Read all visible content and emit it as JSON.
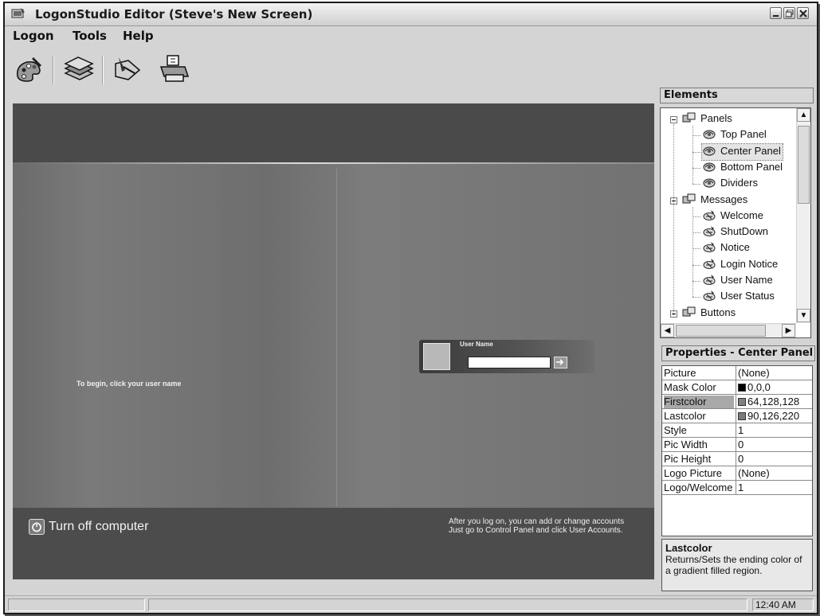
{
  "window": {
    "title": "LogonStudio Editor (Steve's New Screen)",
    "icons": {
      "app": "logonstudio-app-icon",
      "minimize": "minimize-icon",
      "maximize": "maximize-icon",
      "close": "close-icon"
    }
  },
  "menu": {
    "items": [
      "Logon",
      "Tools",
      "Help"
    ]
  },
  "toolbar": {
    "buttons": [
      {
        "icon": "palette-icon"
      },
      {
        "icon": "layers-icon"
      },
      {
        "icon": "pointer-hand-icon"
      },
      {
        "icon": "printer-icon"
      }
    ]
  },
  "preview": {
    "welcome_text": "To begin, click your user name",
    "user_name_label": "User Name",
    "password_value": "",
    "go_icon": "go-arrow-icon",
    "turn_off_label": "Turn off computer",
    "power_icon": "power-icon",
    "after_logon_line1": "After you log on, you can add or change accounts",
    "after_logon_line2": "Just go to Control Panel and click User Accounts."
  },
  "elements": {
    "heading": "Elements",
    "tree": [
      {
        "label": "Panels",
        "level": 0,
        "expanded": true,
        "icon": "folder-group-icon"
      },
      {
        "label": "Top Panel",
        "level": 1,
        "icon": "panel-item-icon"
      },
      {
        "label": "Center Panel",
        "level": 1,
        "icon": "panel-item-icon",
        "selected": true
      },
      {
        "label": "Bottom Panel",
        "level": 1,
        "icon": "panel-item-icon"
      },
      {
        "label": "Dividers",
        "level": 1,
        "icon": "panel-item-icon"
      },
      {
        "label": "Messages",
        "level": 0,
        "expanded": true,
        "icon": "folder-group-icon"
      },
      {
        "label": "Welcome",
        "level": 1,
        "icon": "message-item-icon"
      },
      {
        "label": "ShutDown",
        "level": 1,
        "icon": "message-item-icon"
      },
      {
        "label": "Notice",
        "level": 1,
        "icon": "message-item-icon"
      },
      {
        "label": "Login Notice",
        "level": 1,
        "icon": "message-item-icon"
      },
      {
        "label": "User Name",
        "level": 1,
        "icon": "message-item-icon"
      },
      {
        "label": "User Status",
        "level": 1,
        "icon": "message-item-icon"
      },
      {
        "label": "Buttons",
        "level": 0,
        "expanded": true,
        "icon": "folder-group-icon"
      }
    ]
  },
  "properties": {
    "heading": "Properties - Center Panel",
    "rows": [
      {
        "name": "Picture",
        "value": "(None)"
      },
      {
        "name": "Mask Color",
        "value": "0,0,0",
        "swatch": "#000000"
      },
      {
        "name": "Firstcolor",
        "value": "64,128,128",
        "swatch": "#808080",
        "highlight": true
      },
      {
        "name": "Lastcolor",
        "value": "90,126,220",
        "swatch": "#7a7a7a"
      },
      {
        "name": "Style",
        "value": "1"
      },
      {
        "name": "Pic Width",
        "value": "0"
      },
      {
        "name": "Pic Height",
        "value": "0"
      },
      {
        "name": "Logo Picture",
        "value": "(None)"
      },
      {
        "name": "Logo/Welcome",
        "value": "1"
      }
    ]
  },
  "description": {
    "title": "Lastcolor",
    "text": "Returns/Sets the ending color of a gradient filled region."
  },
  "status": {
    "left": "",
    "middle": "",
    "clock": "12:40 AM"
  },
  "colors": {
    "chrome": "#d4d4d4",
    "top_panel": "#4a4a4a",
    "center_panel": "#6e6e6e",
    "bottom_panel": "#4c4c4c"
  }
}
